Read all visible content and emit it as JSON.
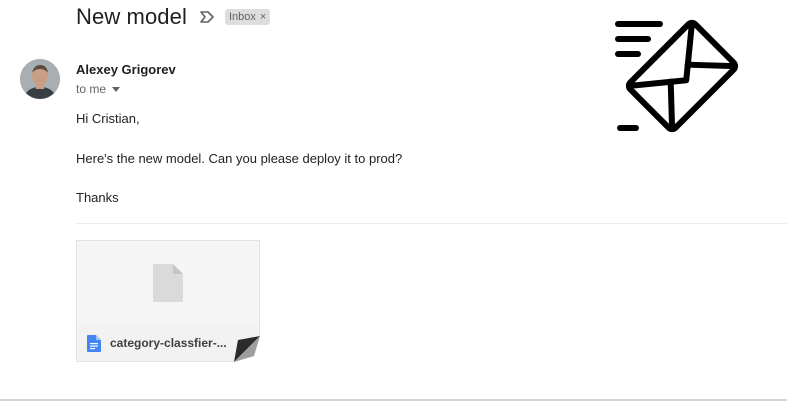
{
  "email": {
    "subject": "New model",
    "label_chip": "Inbox",
    "label_chip_close": "×",
    "sender_name": "Alexey Grigorev",
    "to_line": "to me",
    "body": {
      "greeting": "Hi Cristian,",
      "message": "Here's the new model. Can you please deploy it to prod?",
      "signoff": "Thanks"
    },
    "attachment": {
      "filename": "category-classfier-...",
      "icon": "google-docs-icon"
    }
  },
  "icons": {
    "important_marker": "important-icon",
    "avatar": "avatar",
    "expand_recipients": "chevron-down-icon",
    "logo": "fast-mail-icon"
  },
  "colors": {
    "attachment_doc_blue": "#4285f4",
    "logo_stroke": "#000000",
    "chip_background": "#dddddd"
  }
}
